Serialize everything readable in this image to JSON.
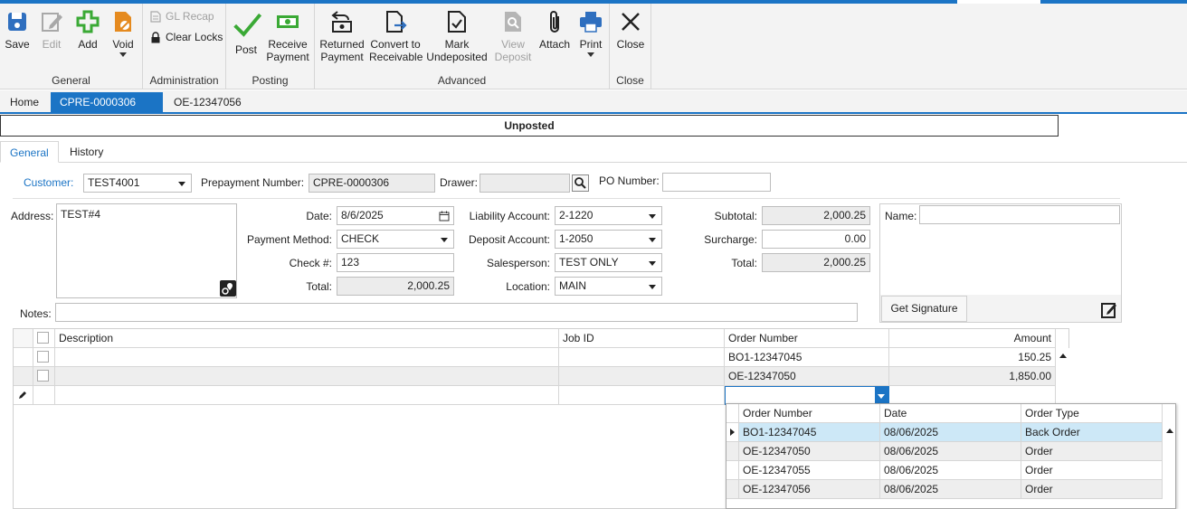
{
  "ribbon": {
    "general": {
      "label": "General",
      "save": "Save",
      "edit": "Edit",
      "add": "Add",
      "void": "Void"
    },
    "administration": {
      "label": "Administration",
      "gl_recap": "GL Recap",
      "clear_locks": "Clear Locks"
    },
    "posting": {
      "label": "Posting",
      "post": "Post",
      "receive_payment_1": "Receive",
      "receive_payment_2": "Payment"
    },
    "advanced": {
      "label": "Advanced",
      "returned_payment_1": "Returned",
      "returned_payment_2": "Payment",
      "convert_1": "Convert to",
      "convert_2": "Receivable",
      "mark_1": "Mark",
      "mark_2": "Undeposited",
      "view_1": "View",
      "view_2": "Deposit",
      "attach": "Attach",
      "print": "Print"
    },
    "close": {
      "label": "Close",
      "close": "Close"
    }
  },
  "doc_tabs": {
    "home": "Home",
    "active": "CPRE-0000306",
    "other": "OE-12347056"
  },
  "status": "Unposted",
  "section_tabs": {
    "general": "General",
    "history": "History"
  },
  "form": {
    "customer_label": "Customer:",
    "customer_value": "TEST4001",
    "prepayment_label": "Prepayment Number:",
    "prepayment_value": "CPRE-0000306",
    "drawer_label": "Drawer:",
    "drawer_value": "",
    "po_label": "PO Number:",
    "po_value": "",
    "address_label": "Address:",
    "address_value": "TEST#4",
    "date_label": "Date:",
    "date_value": "8/6/2025",
    "payment_method_label": "Payment Method:",
    "payment_method_value": "CHECK",
    "check_label": "Check #:",
    "check_value": "123",
    "total_left_label": "Total:",
    "total_left_value": "2,000.25",
    "liability_label": "Liability Account:",
    "liability_value": "2-1220",
    "deposit_label": "Deposit Account:",
    "deposit_value": "1-2050",
    "salesperson_label": "Salesperson:",
    "salesperson_value": "TEST ONLY",
    "location_label": "Location:",
    "location_value": "MAIN",
    "subtotal_label": "Subtotal:",
    "subtotal_value": "2,000.25",
    "surcharge_label": "Surcharge:",
    "surcharge_value": "0.00",
    "total_label": "Total:",
    "total_value": "2,000.25",
    "name_label": "Name:",
    "name_value": "",
    "get_signature": "Get Signature",
    "notes_label": "Notes:",
    "notes_value": ""
  },
  "grid": {
    "headers": {
      "description": "Description",
      "job_id": "Job ID",
      "order_number": "Order Number",
      "amount": "Amount"
    },
    "rows": [
      {
        "description": "",
        "job_id": "",
        "order_number": "BO1-12347045",
        "amount": "150.25"
      },
      {
        "description": "",
        "job_id": "",
        "order_number": "OE-12347050",
        "amount": "1,850.00"
      }
    ]
  },
  "popup": {
    "headers": {
      "order_number": "Order Number",
      "date": "Date",
      "order_type": "Order Type"
    },
    "rows": [
      {
        "order_number": "BO1-12347045",
        "date": "08/06/2025",
        "order_type": "Back Order"
      },
      {
        "order_number": "OE-12347050",
        "date": "08/06/2025",
        "order_type": "Order"
      },
      {
        "order_number": "OE-12347055",
        "date": "08/06/2025",
        "order_type": "Order"
      },
      {
        "order_number": "OE-12347056",
        "date": "08/06/2025",
        "order_type": "Order"
      }
    ]
  },
  "colors": {
    "accent": "#1b74c5",
    "selected_row": "#cde8f7",
    "save_icon": "#2f6fbf",
    "add_icon": "#3aa935",
    "void_icon": "#e58a1f",
    "post_icon": "#3aa935",
    "print_icon": "#2f6fbf"
  },
  "icons": {
    "save": "save-disk-icon",
    "edit": "edit-pencil-icon",
    "add": "add-plus-icon",
    "void": "void-document-icon",
    "gl_recap": "gl-recap-icon",
    "clear_locks": "lock-icon",
    "post": "checkmark-icon",
    "receive_payment": "cash-icon",
    "returned_payment": "returned-payment-icon",
    "convert": "convert-document-icon",
    "mark_undeposited": "mark-document-icon",
    "view_deposit": "view-deposit-icon",
    "attach": "paperclip-icon",
    "print": "printer-icon",
    "close": "close-x-icon"
  }
}
